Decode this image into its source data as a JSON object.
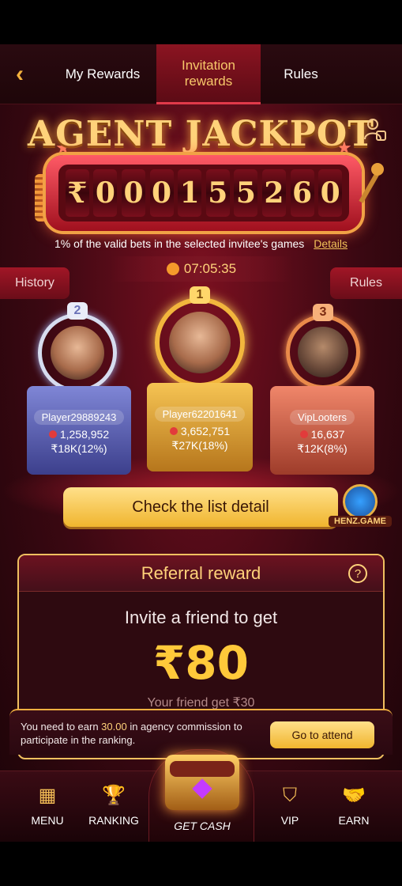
{
  "tabs": {
    "my_rewards": "My Rewards",
    "invitation_rewards": "Invitation rewards",
    "rules": "Rules"
  },
  "jackpot": {
    "title": "AGENT JACKPOT",
    "currency": "₹",
    "digits": [
      "0",
      "0",
      "0",
      "1",
      "5",
      "5",
      "2",
      "6",
      "0"
    ],
    "subtitle": "1% of the valid bets in the selected invitee's games",
    "details_link": "Details",
    "timer": "07:05:35"
  },
  "side_buttons": {
    "history": "History",
    "rules": "Rules"
  },
  "leaderboard": [
    {
      "rank": "2",
      "name": "Player29889243",
      "score": "1,258,952",
      "reward": "₹18K(12%)"
    },
    {
      "rank": "1",
      "name": "Player62201641",
      "score": "3,652,751",
      "reward": "₹27K(18%)"
    },
    {
      "rank": "3",
      "name": "VipLooters",
      "score": "16,637",
      "reward": "₹12K(8%)"
    }
  ],
  "check_list_button": "Check the list detail",
  "brand_badge": "HENZ.GAME",
  "referral": {
    "title": "Referral reward",
    "line": "Invite a friend to get",
    "amount": "₹80",
    "sub": "Your friend get ₹30"
  },
  "notice": {
    "text_prefix": "You need to earn ",
    "amount": "30.00",
    "text_suffix": " in agency commission to participate in the ranking.",
    "button": "Go to attend"
  },
  "bottom_nav": {
    "menu": "MENU",
    "ranking": "RANKING",
    "get_cash": "GET CASH",
    "vip": "VIP",
    "earn": "EARN"
  },
  "colors": {
    "accent_gold": "#ffd27a",
    "button_gold": "#f0b52e",
    "background_red": "#3b0812"
  }
}
